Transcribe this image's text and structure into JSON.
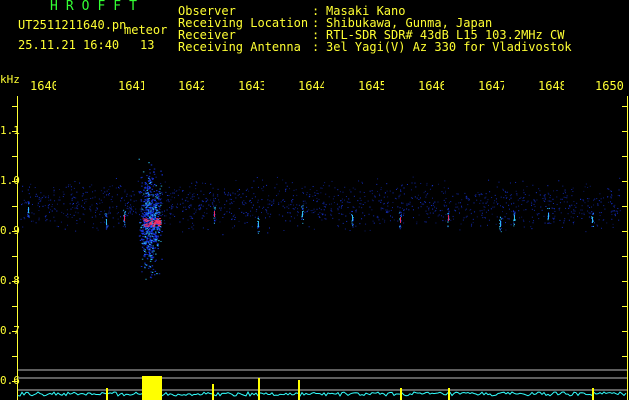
{
  "header": {
    "app_title": "HROFFT",
    "file_name": "UT2511211640.pn",
    "mode": "meteor",
    "datetime": "25.11.21 16:40",
    "count": "13"
  },
  "info": [
    {
      "key": "Observer",
      "sep": ":",
      "value": "Masaki Kano"
    },
    {
      "key": "Receiving Location",
      "sep": ":",
      "value": "Shibukawa, Gunma, Japan"
    },
    {
      "key": "Receiver",
      "sep": ":",
      "value": "RTL-SDR SDR# 43dB L15 103.2MHz CW"
    },
    {
      "key": "Receiving Antenna",
      "sep": ":",
      "value": "3el Yagi(V) Az 330 for Vladivostok"
    }
  ],
  "axis": {
    "y_unit": "kHz",
    "x_ticks": [
      "1640",
      "1641",
      "1642",
      "1643",
      "1644",
      "1645",
      "1646",
      "1647",
      "1648",
      "1649",
      "1650"
    ],
    "y_ticks": [
      "1.1",
      "1.0",
      "0.9",
      "0.8",
      "0.7",
      "0.6"
    ]
  },
  "colors": {
    "text_primary": "#ffff33",
    "title": "#33ff33",
    "background": "#000000",
    "signal_low": "#1a3cff",
    "signal_mid": "#33ccff",
    "signal_high": "#ff3366",
    "meter_trace": "#33ffff",
    "meter_peak": "#ffff00"
  }
}
